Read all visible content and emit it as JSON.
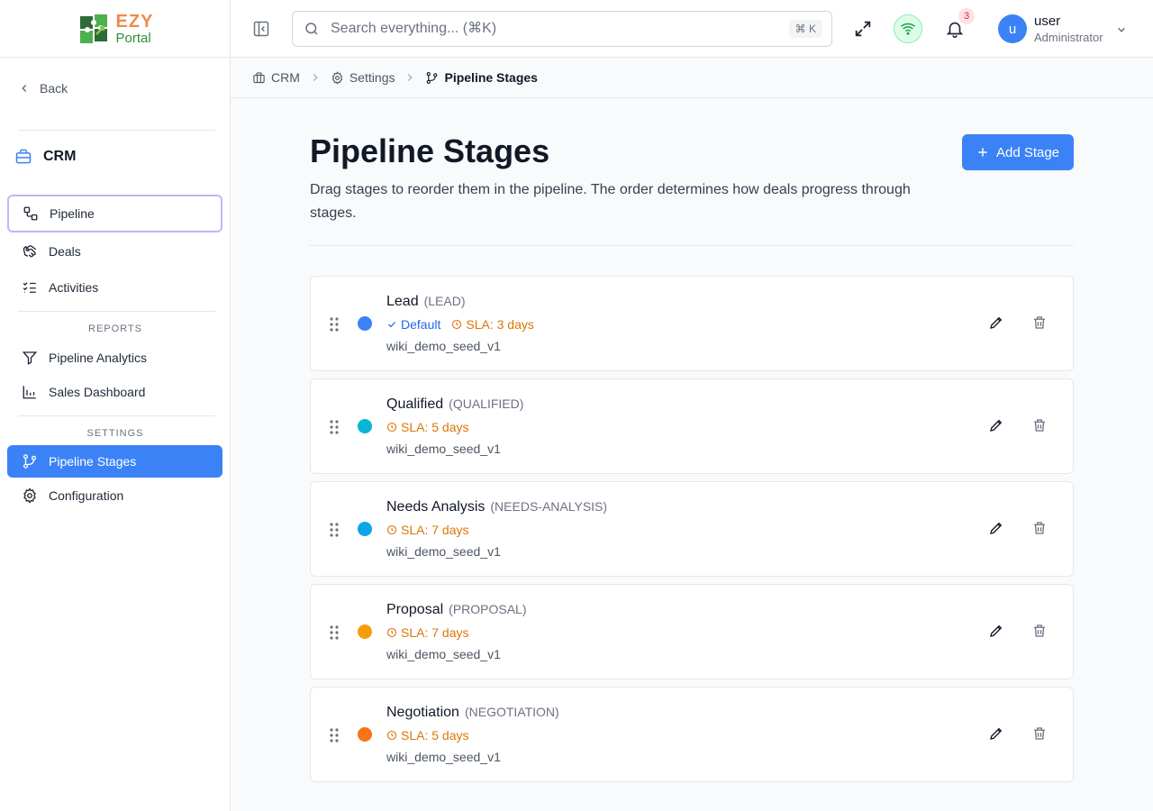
{
  "brand": {
    "line1": "EZY",
    "line2": "Portal"
  },
  "sidebar": {
    "back_label": "Back",
    "module_title": "CRM",
    "items": [
      {
        "label": "Pipeline"
      },
      {
        "label": "Deals"
      },
      {
        "label": "Activities"
      }
    ],
    "reports_label": "REPORTS",
    "reports": [
      {
        "label": "Pipeline Analytics"
      },
      {
        "label": "Sales Dashboard"
      }
    ],
    "settings_label": "SETTINGS",
    "settings": [
      {
        "label": "Pipeline Stages"
      },
      {
        "label": "Configuration"
      }
    ]
  },
  "header": {
    "search_placeholder": "Search everything... (⌘K)",
    "search_shortcut": "⌘ K",
    "notification_count": "3",
    "user_initial": "u",
    "user_name": "user",
    "user_role": "Administrator"
  },
  "breadcrumb": [
    "CRM",
    "Settings",
    "Pipeline Stages"
  ],
  "page": {
    "title": "Pipeline Stages",
    "description": "Drag stages to reorder them in the pipeline. The order determines how deals progress through stages.",
    "add_button": "Add Stage"
  },
  "stages": [
    {
      "name": "Lead",
      "code": "(LEAD)",
      "color": "#3b82f6",
      "default": "Default",
      "sla": "SLA: 3 days",
      "source": "wiki_demo_seed_v1"
    },
    {
      "name": "Qualified",
      "code": "(QUALIFIED)",
      "color": "#06b6d4",
      "sla": "SLA: 5 days",
      "source": "wiki_demo_seed_v1"
    },
    {
      "name": "Needs Analysis",
      "code": "(NEEDS-ANALYSIS)",
      "color": "#0ea5e9",
      "sla": "SLA: 7 days",
      "source": "wiki_demo_seed_v1"
    },
    {
      "name": "Proposal",
      "code": "(PROPOSAL)",
      "color": "#f59e0b",
      "sla": "SLA: 7 days",
      "source": "wiki_demo_seed_v1"
    },
    {
      "name": "Negotiation",
      "code": "(NEGOTIATION)",
      "color": "#f97316",
      "sla": "SLA: 5 days",
      "source": "wiki_demo_seed_v1"
    }
  ],
  "colors": {
    "accent": "#3b82f6",
    "sla": "#d97706",
    "default_tag": "#2563eb"
  }
}
